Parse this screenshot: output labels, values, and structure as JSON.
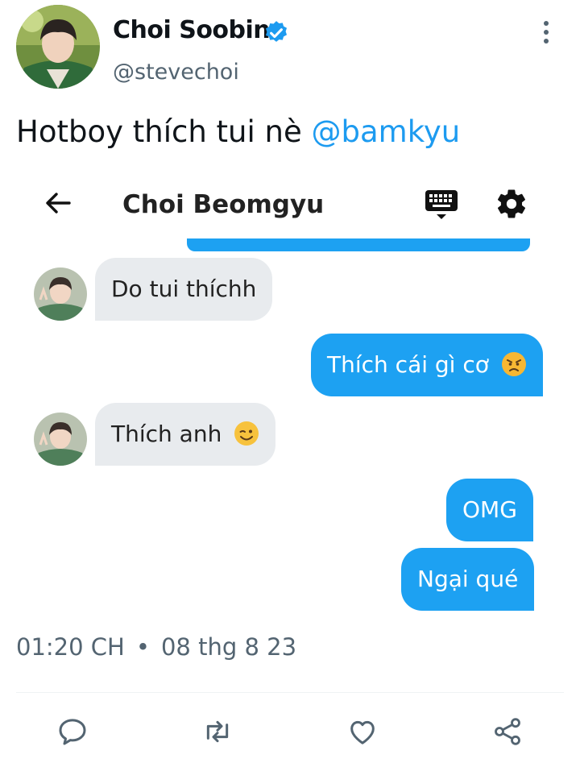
{
  "tweet": {
    "author": {
      "display_name": "Choi Soobin",
      "handle": "@stevechoi",
      "verified": true
    },
    "text": "Hotboy thích tui nè ",
    "mention": "@bamkyu",
    "time": "01:20 CH",
    "separator": "•",
    "date": "08 thg 8 23"
  },
  "chat": {
    "title": "Choi Beomgyu",
    "messages": [
      {
        "side": "in",
        "text": "Do tui thíchh"
      },
      {
        "side": "out",
        "text": "Thích cái gì cơ ",
        "emoji": "angry-face"
      },
      {
        "side": "in",
        "text": "Thích anh ",
        "emoji": "winking-face"
      },
      {
        "side": "out",
        "text": "OMG"
      },
      {
        "side": "out",
        "text": "Ngại qué"
      }
    ]
  },
  "colors": {
    "accent": "#1d9bf0",
    "bubble_out": "#1da1f2",
    "bubble_in": "#e8ebee",
    "muted": "#536471"
  }
}
